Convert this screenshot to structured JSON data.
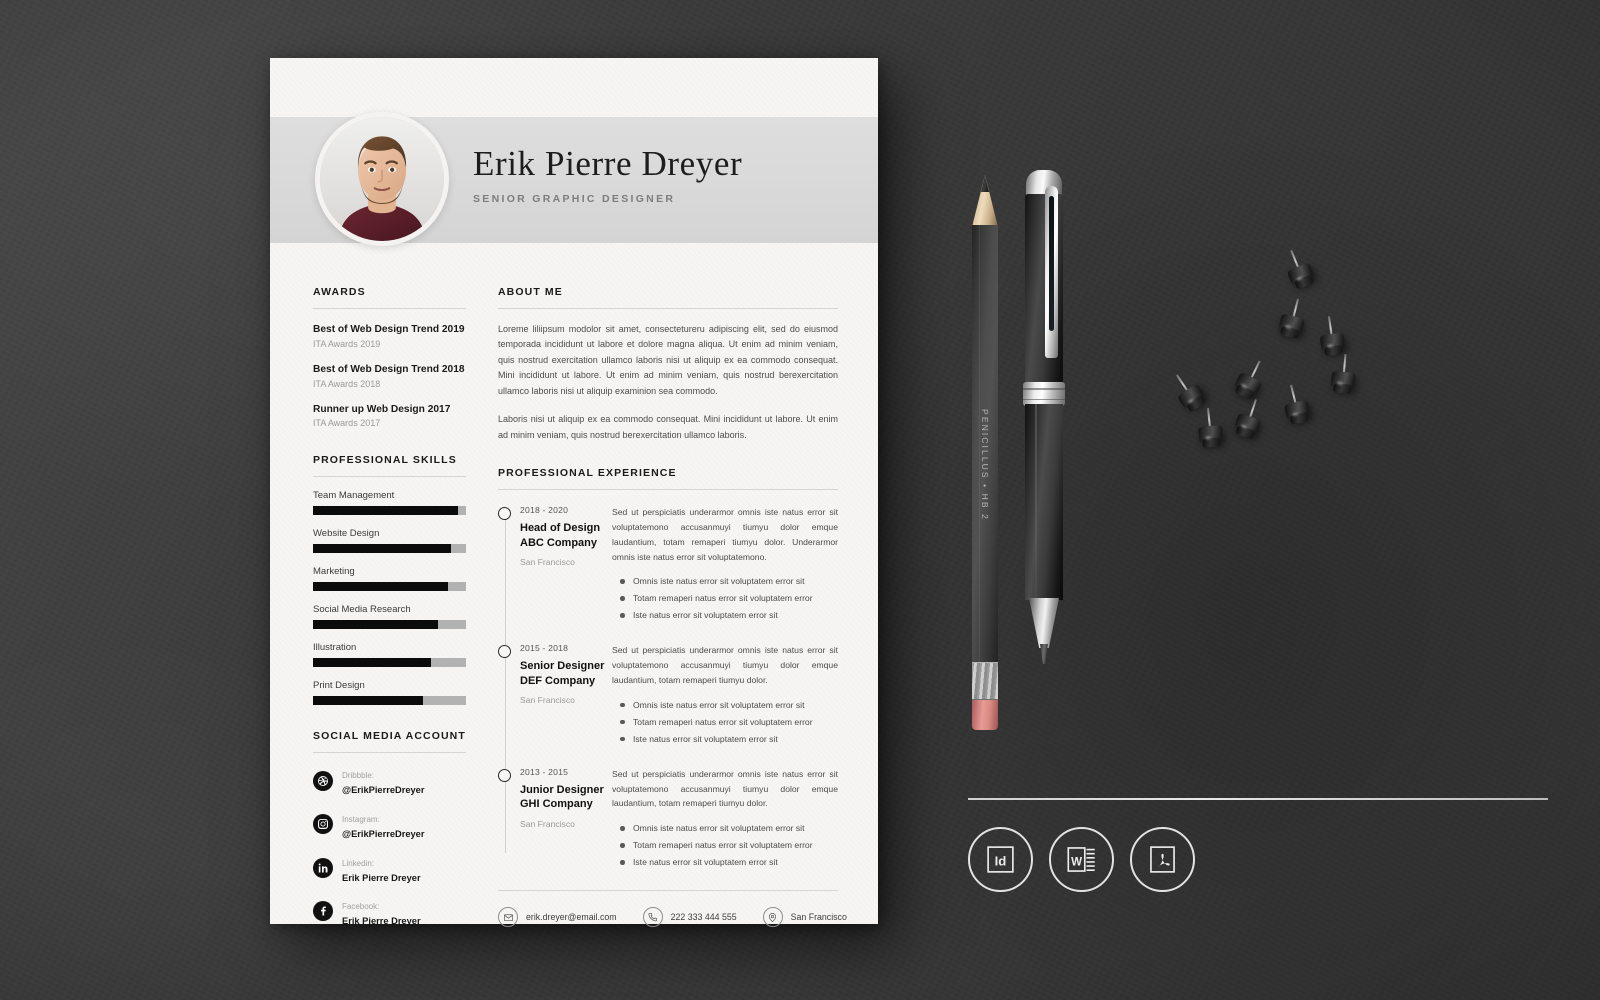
{
  "scene": {
    "background_color": "#3b3b3b",
    "surface": "dark-textured-desk"
  },
  "resume": {
    "paper_color": "#f7f6f4",
    "header": {
      "band_color": "#d9d9d9",
      "full_name": "Erik Pierre Dreyer",
      "job_title": "SENIOR GRAPHIC DESIGNER",
      "avatar_name": "profile-photo"
    },
    "left_column": {
      "awards": {
        "title": "AWARDS",
        "items": [
          {
            "name": "Best of Web Design Trend 2019",
            "sub": "ITA Awards 2019"
          },
          {
            "name": "Best of Web Design Trend 2018",
            "sub": "ITA Awards 2018"
          },
          {
            "name": "Runner up Web Design 2017",
            "sub": "ITA Awards 2017"
          }
        ]
      },
      "skills": {
        "title": "PROFESSIONAL SKILLS",
        "fill_color": "#0b0b0b",
        "track_color": "#b2b2b2",
        "items": [
          {
            "label": "Team Management",
            "percent": 95
          },
          {
            "label": "Website Design",
            "percent": 90
          },
          {
            "label": "Marketing",
            "percent": 88
          },
          {
            "label": "Social Media Research",
            "percent": 82
          },
          {
            "label": "Illustration",
            "percent": 77
          },
          {
            "label": "Print Design",
            "percent": 72
          }
        ]
      },
      "social": {
        "title": "SOCIAL MEDIA ACCOUNT",
        "items": [
          {
            "icon": "dribbble-icon",
            "label": "Dribbble:",
            "handle": "@ErikPierreDreyer"
          },
          {
            "icon": "instagram-icon",
            "label": "Instagram:",
            "handle": "@ErikPierreDreyer"
          },
          {
            "icon": "linkedin-icon",
            "label": "Linkedin:",
            "handle": "Erik Pierre Dreyer"
          },
          {
            "icon": "facebook-icon",
            "label": "Facebook:",
            "handle": "Erik Pierre Dreyer"
          }
        ]
      }
    },
    "right_column": {
      "about": {
        "title": "ABOUT ME",
        "paragraphs": [
          "Loreme liliipsum modolor sit amet, consectetureru adipiscing elit, sed do eiusmod temporada incididunt ut labore et dolore magna aliqua. Ut enim ad minim veniam, quis nostrud exercitation ullamco laboris nisi ut aliquip ex ea commodo consequat. Mini incididunt ut labore. Ut enim ad minim veniam, quis nostrud berexercitation ullamco laboris nisi ut aliquip examinion sea commodo.",
          "Laboris nisi ut aliquip ex ea commodo consequat. Mini incididunt ut labore. Ut enim ad minim veniam, quis nostrud berexercitation ullamco laboris."
        ]
      },
      "experience": {
        "title": "PROFESSIONAL EXPERIENCE",
        "items": [
          {
            "years": "2018 - 2020",
            "role": "Head of Design",
            "company": "ABC Company",
            "location": "San Francisco",
            "description": "Sed ut perspiciatis underarmor omnis iste natus error sit voluptatemono accusanmuyi tiumyu dolor emque laudantium, totam remaperi tiumyu dolor. Underarmor omnis iste natus error sit voluptatemono.",
            "bullets": [
              "Omnis iste natus error sit voluptatem error sit",
              "Totam remaperi natus error sit voluptatem error",
              "Iste natus error sit voluptatem error sit"
            ]
          },
          {
            "years": "2015 - 2018",
            "role": "Senior Designer",
            "company": "DEF Company",
            "location": "San Francisco",
            "description": "Sed ut perspiciatis underarmor omnis iste natus error sit voluptatemono accusanmuyi tiumyu dolor emque laudantium, totam remaperi tiumyu dolor.",
            "bullets": [
              "Omnis iste natus error sit voluptatem error sit",
              "Totam remaperi natus error sit voluptatem error",
              "Iste natus error sit voluptatem error sit"
            ]
          },
          {
            "years": "2013 - 2015",
            "role": "Junior Designer",
            "company": "GHI Company",
            "location": "San Francisco",
            "description": "Sed ut perspiciatis underarmor omnis iste natus error sit voluptatemono accusanmuyi tiumyu dolor emque laudantium, totam remaperi tiumyu dolor.",
            "bullets": [
              "Omnis iste natus error sit voluptatem error sit",
              "Totam remaperi natus error sit voluptatem error",
              "Iste natus error sit voluptatem error sit"
            ]
          }
        ]
      },
      "contacts": [
        {
          "icon": "mail-icon",
          "value": "erik.dreyer@email.com"
        },
        {
          "icon": "phone-icon",
          "value": "222 333 444 555"
        },
        {
          "icon": "location-pin-icon",
          "value": "San Francisco"
        }
      ]
    }
  },
  "props": {
    "pencil": {
      "label": "PENICILLUS  •  HB 2",
      "body_color": "#4a4a4a",
      "eraser_color": "#d98a83"
    },
    "pen": {
      "body_color": "#1a1a1a",
      "accent_color": "#e6e6e6"
    },
    "pushpins_count": 9
  },
  "format_badges": [
    {
      "name": "indesign-badge",
      "label": "Id"
    },
    {
      "name": "word-badge",
      "label": "W"
    },
    {
      "name": "pdf-badge",
      "label": "PDF"
    }
  ]
}
